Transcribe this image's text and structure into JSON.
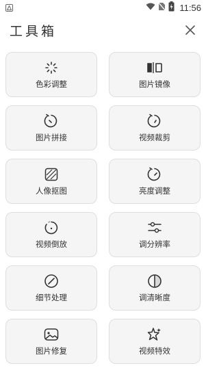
{
  "status_bar": {
    "time": "11:56",
    "icons": [
      "app-notification-icon",
      "wifi-icon",
      "no-sim-icon",
      "battery-charging-icon"
    ]
  },
  "header": {
    "title": "工具箱",
    "close_icon": "close-icon"
  },
  "tools": [
    {
      "label": "色彩调整",
      "icon": "color-adjust-icon"
    },
    {
      "label": "图片镜像",
      "icon": "mirror-icon"
    },
    {
      "label": "图片拼接",
      "icon": "stitch-icon"
    },
    {
      "label": "视频裁剪",
      "icon": "video-crop-icon"
    },
    {
      "label": "人像抠图",
      "icon": "portrait-cutout-icon"
    },
    {
      "label": "亮度调整",
      "icon": "brightness-icon"
    },
    {
      "label": "视频倒放",
      "icon": "video-reverse-icon"
    },
    {
      "label": "调分辨率",
      "icon": "resolution-icon"
    },
    {
      "label": "细节处理",
      "icon": "detail-icon"
    },
    {
      "label": "调清晰度",
      "icon": "sharpness-icon"
    },
    {
      "label": "图片修复",
      "icon": "photo-repair-icon"
    },
    {
      "label": "视频特效",
      "icon": "video-effects-icon"
    }
  ]
}
